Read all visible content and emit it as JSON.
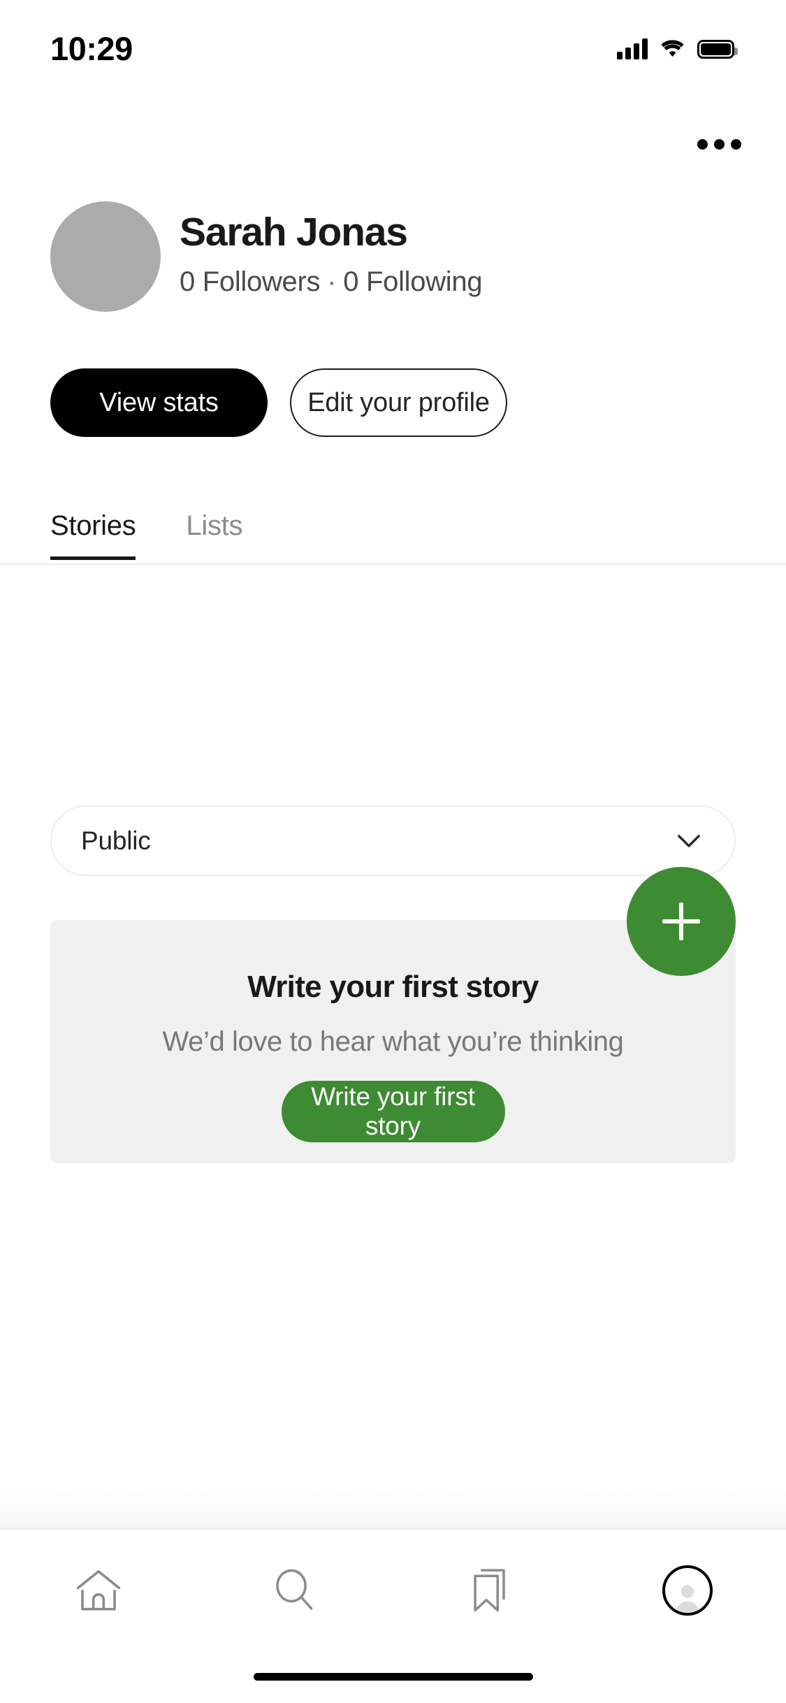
{
  "status_bar": {
    "time": "10:29",
    "cellular_icon": "cellular-signal-icon",
    "wifi_icon": "wifi-icon",
    "battery_icon": "battery-full-icon"
  },
  "header": {
    "overflow_icon": "more-options-icon"
  },
  "profile": {
    "avatar": "user-avatar-placeholder",
    "name": "Sarah Jonas",
    "followers": "0 Followers",
    "separator": "·",
    "following": "0 Following"
  },
  "actions": {
    "view_stats_label": "View stats",
    "edit_profile_label": "Edit your profile"
  },
  "tabs": [
    {
      "label": "Stories",
      "active": true
    },
    {
      "label": "Lists",
      "active": false
    }
  ],
  "visibility": {
    "selected": "Public",
    "chevron_icon": "chevron-down-icon"
  },
  "empty_state": {
    "title": "Write your first story",
    "subtitle": "We’d love to hear what you’re thinking",
    "button_label": "Write your first story"
  },
  "fab": {
    "icon": "plus-icon"
  },
  "bottom_nav": [
    {
      "name": "home",
      "icon": "home-icon",
      "active": false
    },
    {
      "name": "search",
      "icon": "search-icon",
      "active": false
    },
    {
      "name": "bookmarks",
      "icon": "bookmark-icon",
      "active": false
    },
    {
      "name": "profile",
      "icon": "profile-avatar-icon",
      "active": true
    }
  ],
  "colors": {
    "accent_green": "#3d8b32",
    "primary_black": "#000000",
    "card_background": "#f0f0f0",
    "muted_text": "#787878"
  }
}
